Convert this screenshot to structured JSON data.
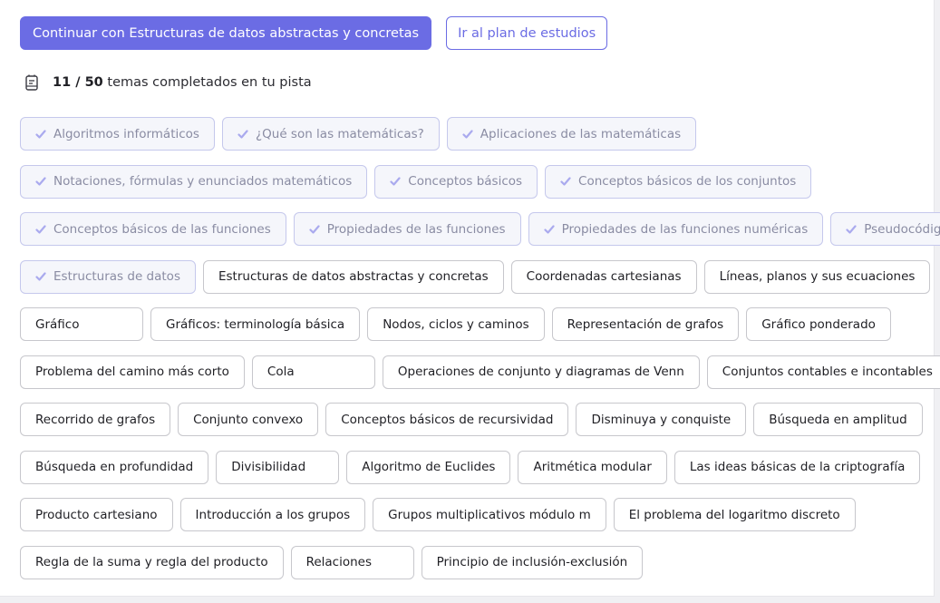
{
  "actions": {
    "continue_label": "Continuar con Estructuras de datos abstractas y concretas",
    "plan_label": "Ir al plan de estudios"
  },
  "progress": {
    "completed": "11",
    "total": "50",
    "separator": " / ",
    "text": "temas completados en tu pista",
    "icon": "notebook-icon"
  },
  "colors": {
    "accent": "#6b6ce4",
    "completed_border": "#c5c8ec",
    "completed_bg": "#f5f6fb"
  },
  "topics": [
    {
      "label": "Algoritmos informáticos",
      "completed": true
    },
    {
      "label": "¿Qué son las matemáticas?",
      "completed": true
    },
    {
      "label": "Aplicaciones de las matemáticas",
      "completed": true
    },
    {
      "label": "Notaciones, fórmulas y enunciados matemáticos",
      "completed": true
    },
    {
      "label": "Conceptos básicos",
      "completed": true
    },
    {
      "label": "Conceptos básicos de los conjuntos",
      "completed": true
    },
    {
      "label": "Conceptos básicos de las funciones",
      "completed": true
    },
    {
      "label": "Propiedades de las funciones",
      "completed": true
    },
    {
      "label": "Propiedades de las funciones numéricas",
      "completed": true
    },
    {
      "label": "Pseudocódigo",
      "completed": true
    },
    {
      "label": "Estructuras de datos",
      "completed": true
    },
    {
      "label": "Estructuras de datos abstractas y concretas",
      "completed": false
    },
    {
      "label": "Coordenadas cartesianas",
      "completed": false
    },
    {
      "label": "Líneas, planos y sus ecuaciones",
      "completed": false
    },
    {
      "label": "Gráfico",
      "completed": false
    },
    {
      "label": "Gráficos: terminología básica",
      "completed": false
    },
    {
      "label": "Nodos, ciclos y caminos",
      "completed": false
    },
    {
      "label": "Representación de grafos",
      "completed": false
    },
    {
      "label": "Gráfico ponderado",
      "completed": false
    },
    {
      "label": "Problema del camino más corto",
      "completed": false
    },
    {
      "label": "Cola",
      "completed": false
    },
    {
      "label": "Operaciones de conjunto y diagramas de Venn",
      "completed": false
    },
    {
      "label": "Conjuntos contables e incontables",
      "completed": false
    },
    {
      "label": "Recorrido de grafos",
      "completed": false
    },
    {
      "label": "Conjunto convexo",
      "completed": false
    },
    {
      "label": "Conceptos básicos de recursividad",
      "completed": false
    },
    {
      "label": "Disminuya y conquiste",
      "completed": false
    },
    {
      "label": "Búsqueda en amplitud",
      "completed": false
    },
    {
      "label": "Búsqueda en profundidad",
      "completed": false
    },
    {
      "label": "Divisibilidad",
      "completed": false
    },
    {
      "label": "Algoritmo de Euclides",
      "completed": false
    },
    {
      "label": "Aritmética modular",
      "completed": false
    },
    {
      "label": "Las ideas básicas de la criptografía",
      "completed": false
    },
    {
      "label": "Producto cartesiano",
      "completed": false
    },
    {
      "label": "Introducción a los grupos",
      "completed": false
    },
    {
      "label": "Grupos multiplicativos módulo m",
      "completed": false
    },
    {
      "label": "El problema del logaritmo discreto",
      "completed": false
    },
    {
      "label": "Regla de la suma y regla del producto",
      "completed": false
    },
    {
      "label": "Relaciones",
      "completed": false
    },
    {
      "label": "Principio de inclusión-exclusión",
      "completed": false
    }
  ]
}
